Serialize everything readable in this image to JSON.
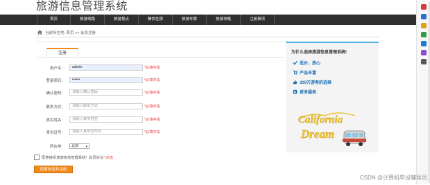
{
  "site": {
    "title": "旅游信息管理系统"
  },
  "nav": {
    "items": [
      "首页",
      "旅游线路",
      "旅游景点",
      "餐饮住宿",
      "旅游车票",
      "旅游攻略",
      "注册事项"
    ]
  },
  "breadcrumb": {
    "text": "当前所在地: 首页 >> 会员注册"
  },
  "form": {
    "tab": "注册",
    "fields": [
      {
        "label": "用户名:",
        "value": "admin",
        "placeholder": "",
        "hint": "*必填字段"
      },
      {
        "label": "登录密码:",
        "value": "••••••",
        "placeholder": "",
        "hint": "*必填字段"
      },
      {
        "label": "确认密码:",
        "value": "",
        "placeholder": "请输入确认密码",
        "hint": "*必填字段"
      },
      {
        "label": "联系方式:",
        "value": "",
        "placeholder": "请输入联系方式",
        "hint": "*必填字段"
      },
      {
        "label": "真实姓名:",
        "value": "",
        "placeholder": "请输入真实姓名",
        "hint": "*必填字段"
      },
      {
        "label": "身份证号:",
        "value": "",
        "placeholder": "请输入身份证号码",
        "hint": "*必填字段"
      }
    ],
    "region": {
      "label": "所在地:",
      "value": "北京"
    },
    "agree": {
      "text": "愿意接受旅游信息管理系统!",
      "protocol": "会员协议",
      "required": "*必选"
    },
    "submit": "同意协议并注册"
  },
  "aside": {
    "question": "为什么选择旅游信息管理系统!",
    "features": [
      "低价、放心",
      "产品丰富",
      "300万游客的选择",
      "更多服务"
    ],
    "calLine1": "California",
    "calLine2": "Dream"
  },
  "watermark": "CSDN @计算机毕设辅导员",
  "colors": {
    "accent": "#f08a1c",
    "nav": "#2f2f2f",
    "link": "#1a6fb8",
    "required": "#e03b3b",
    "asideTop": "#58b4e6"
  }
}
